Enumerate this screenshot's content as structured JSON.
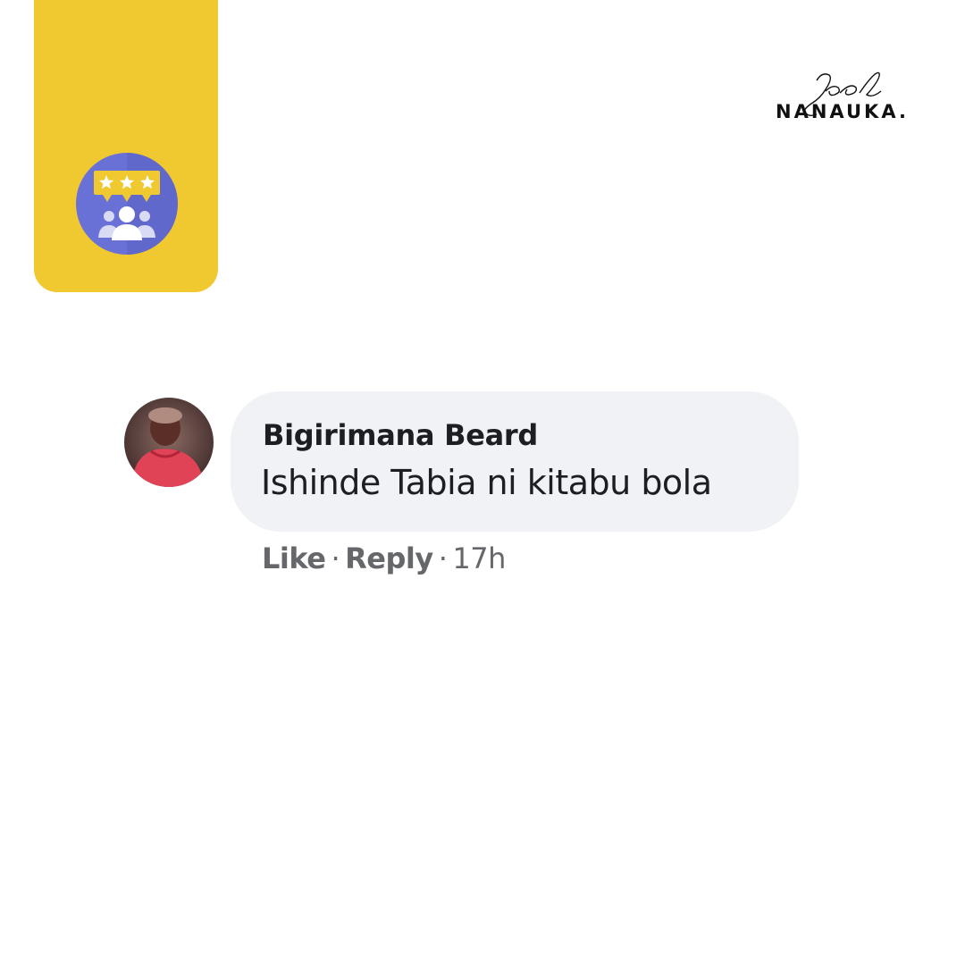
{
  "brand": {
    "logo_script": "Joel",
    "logo_wordmark": "NANAUKA.",
    "panel_color": "#F0C830",
    "badge_color": "#6A71D6",
    "badge_icon": "reviews-icon"
  },
  "comment": {
    "author": "Bigirimana Beard",
    "text": "Ishinde Tabia ni kitabu bola",
    "actions": {
      "like_label": "Like",
      "separator": "·",
      "reply_label": "Reply",
      "timestamp": "17h"
    },
    "bubble_color": "#F0F2F5",
    "text_color": "#1C1E21",
    "meta_color": "#65676B"
  }
}
